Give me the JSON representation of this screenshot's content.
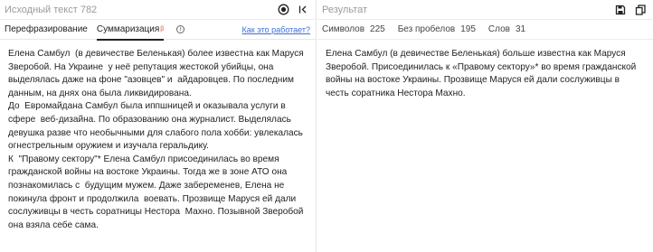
{
  "source": {
    "title": "Исходный текст 782",
    "tabs": [
      {
        "label": "Перефразирование"
      },
      {
        "label": "Суммаризация",
        "badge": "β"
      }
    ],
    "how_link": "Как это работает?",
    "paragraphs": [
      "Елена Самбул  (в девичестве Беленькая) более известна как Маруся Зверобой. На Украине  у неё репутация жестокой убийцы, она выделялась даже на фоне \"азовцев\" и  айдаровцев. По последним данным, на днях она была ликвидирована.",
      "До  Евромайдана Самбул была иппшницей и оказывала услуги в сфере  веб-дизайна. По образованию она журналист. Выделялась девушка разве что необычными для слабого пола хобби: увлекалась огнестрельным оружием и изучала геральдику.",
      "К  \"Правому сектору\"* Елена Самбул присоединилась во время гражданской войны на востоке Украины. Тогда же в зоне АТО она познакомилась с  будущим мужем. Даже забеременев, Елена не покинула фронт и продолжила  воевать. Прозвище Маруся ей дали сослуживцы в честь соратницы Нестора  Махно. Позывной Зверобой она взяла себе сама."
    ],
    "icons": {
      "target": "target-icon",
      "collapse": "collapse-left-icon",
      "info": "info-icon"
    }
  },
  "result": {
    "title": "Результат",
    "stats": [
      {
        "label": "Символов",
        "value": "225"
      },
      {
        "label": "Без пробелов",
        "value": "195"
      },
      {
        "label": "Слов",
        "value": "31"
      }
    ],
    "text": "Елена Самбул (в девичестве Беленькая) больше известна как Маруся Зверобой. Присоединилась к «Правому сектору»* во время гражданской войны на востоке Украины. Прозвище Маруся ей дали сослуживцы в честь соратника Нестора Махно.",
    "icons": {
      "save": "save-icon",
      "copy": "copy-icon"
    }
  }
}
